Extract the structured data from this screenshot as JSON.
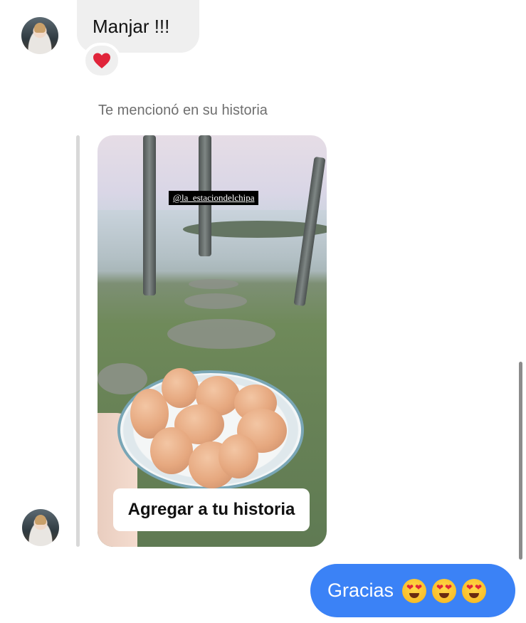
{
  "messages": {
    "incoming_text": "Manjar !!!",
    "reaction_icon": "heart-icon",
    "mention_label": "Te mencionó en su historia",
    "story": {
      "mention_tag": "@la_estaciondelchipa",
      "add_to_story_label": "Agregar a tu historia"
    },
    "outgoing_text": "Gracias",
    "outgoing_emojis": [
      "heart-eyes-emoji",
      "heart-eyes-emoji",
      "heart-eyes-emoji"
    ]
  },
  "colors": {
    "outgoing_bubble": "#3b82f6",
    "incoming_bubble": "#efefef",
    "reaction_heart": "#e0243a"
  }
}
